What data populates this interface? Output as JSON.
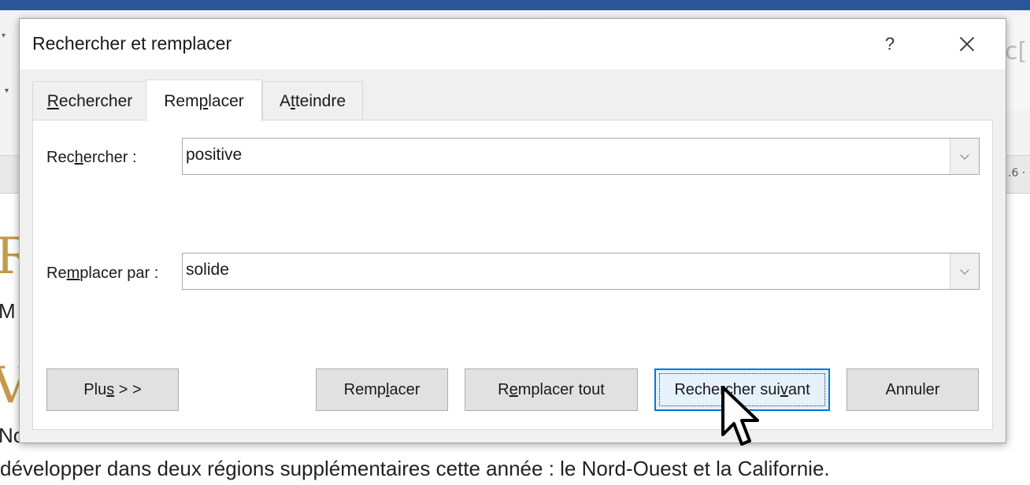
{
  "document": {
    "heading1": "R",
    "sub1": "M",
    "heading2": "V",
    "line1": "No",
    "line2": "développer dans deux régions supplémentaires cette année : le Nord-Ouest et la Californie.",
    "ruler_number": ".6 ·",
    "ribbon_preview": "c["
  },
  "dialog": {
    "title": "Rechercher et remplacer",
    "help_label": "?",
    "tabs": [
      {
        "pre": "",
        "u": "R",
        "post": "echercher",
        "active": false
      },
      {
        "pre": "Rem",
        "u": "p",
        "post": "lacer",
        "active": true
      },
      {
        "pre": "A",
        "u": "t",
        "post": "teindre",
        "active": false
      }
    ],
    "find": {
      "label_pre": "Rec",
      "label_u": "h",
      "label_post": "ercher :",
      "value": "positive"
    },
    "replace": {
      "label_pre": "Re",
      "label_u": "m",
      "label_post": "placer par :",
      "value": "solide"
    },
    "buttons": {
      "plus": {
        "pre": "Plu",
        "u": "s",
        "post": " > >"
      },
      "replace": {
        "pre": "Remp",
        "u": "l",
        "post": "acer"
      },
      "replace_all": {
        "pre": "R",
        "u": "e",
        "post": "mplacer tout"
      },
      "find_next": {
        "pre": "Rechercher sui",
        "u": "v",
        "post": "ant"
      },
      "cancel": "Annuler"
    }
  },
  "colors": {
    "word_blue": "#2b579a",
    "heading_gold": "#c59a4a",
    "focus_blue": "#0078d7"
  }
}
